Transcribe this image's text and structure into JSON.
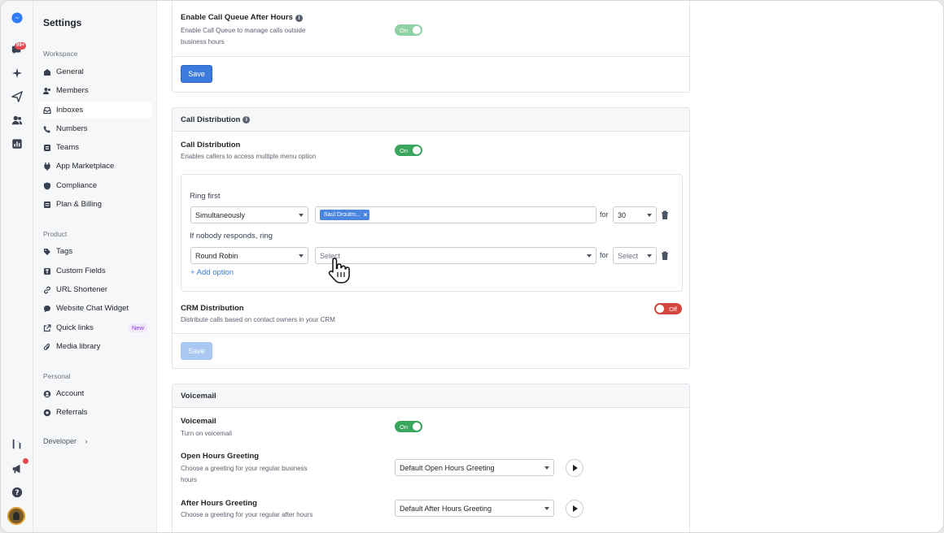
{
  "rail": {
    "notification_count": "99+"
  },
  "sidebar": {
    "title": "Settings",
    "sections": {
      "workspace": "Workspace",
      "product": "Product",
      "personal": "Personal",
      "developer": "Developer"
    },
    "workspace_items": [
      "General",
      "Members",
      "Inboxes",
      "Numbers",
      "Teams",
      "App Marketplace",
      "Compliance",
      "Plan & Billing"
    ],
    "product_items": [
      "Tags",
      "Custom Fields",
      "URL Shortener",
      "Website Chat Widget",
      "Quick links",
      "Media library"
    ],
    "personal_items": [
      "Account",
      "Referrals"
    ],
    "new_badge": "New"
  },
  "queue_card": {
    "title": "Enable Call Queue After Hours",
    "description_line1": "Enable Call Queue to manage calls outside",
    "description_line2": "business hours",
    "toggle": "On",
    "save": "Save"
  },
  "distribution_card": {
    "header": "Call Distribution",
    "title": "Call Distribution",
    "description": "Enables callers to access multiple menu option",
    "toggle": "On",
    "ring_first_label": "Ring first",
    "ring_first_strategy": "Simultaneously",
    "ring_first_chip": "Saul Droutm...",
    "for_label": "for",
    "ring_first_seconds": "30",
    "nobody_label": "If nobody responds, ring",
    "nobody_strategy": "Round Robin",
    "nobody_target_placeholder": "Select",
    "nobody_seconds_placeholder": "Select",
    "add_option": "+ Add option",
    "crm_title": "CRM Distribution",
    "crm_description": "Distribute calls based on contact owners in your CRM",
    "crm_toggle": "Off",
    "save": "Save"
  },
  "voicemail_card": {
    "header": "Voicemail",
    "title": "Voicemail",
    "description": "Turn on voicemail",
    "toggle": "On",
    "open_title": "Open Hours Greeting",
    "open_desc_line1": "Choose a greeting for your regular business",
    "open_desc_line2": "hours",
    "open_select": "Default Open Hours Greeting",
    "after_title": "After Hours Greeting",
    "after_desc": "Choose a greeting for your regular after hours",
    "after_select": "Default After Hours Greeting"
  }
}
